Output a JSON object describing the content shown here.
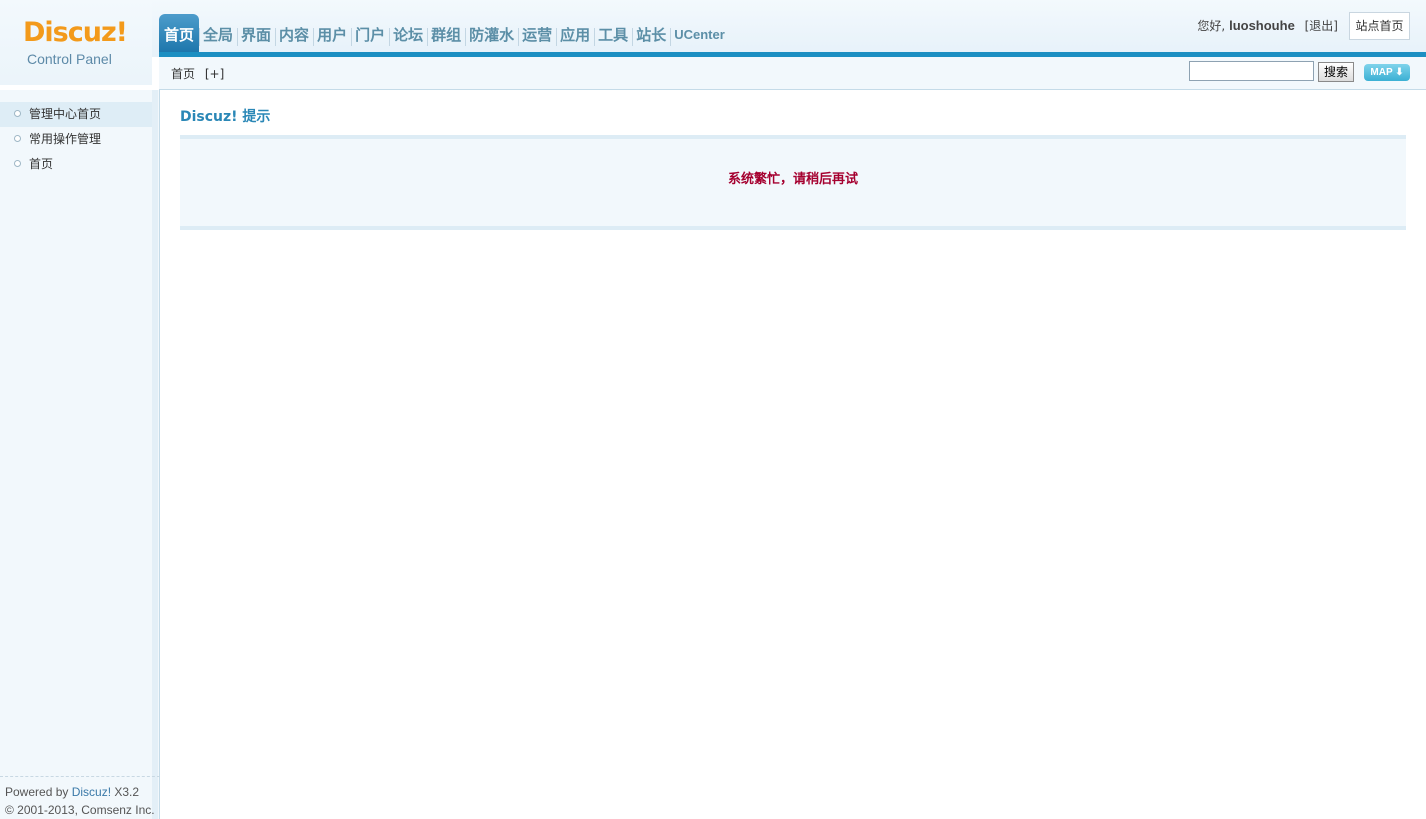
{
  "logo": {
    "wordmark": "Discuz!",
    "subtitle": "Control Panel"
  },
  "nav": {
    "items": [
      {
        "label": "首页",
        "active": true
      },
      {
        "label": "全局"
      },
      {
        "label": "界面"
      },
      {
        "label": "内容"
      },
      {
        "label": "用户"
      },
      {
        "label": "门户"
      },
      {
        "label": "论坛"
      },
      {
        "label": "群组"
      },
      {
        "label": "防灌水"
      },
      {
        "label": "运营"
      },
      {
        "label": "应用"
      },
      {
        "label": "工具"
      },
      {
        "label": "站长"
      },
      {
        "label": "UCenter"
      }
    ]
  },
  "user": {
    "greeting": "您好,",
    "username": "luoshouhe",
    "logout": "[退出]",
    "site_home": "站点首页"
  },
  "subbar": {
    "breadcrumb": "首页",
    "add": "[+]",
    "search_value": "",
    "search_button": "搜索",
    "map_button": "MAP ⬇"
  },
  "sidebar": {
    "items": [
      {
        "label": "管理中心首页"
      },
      {
        "label": "常用操作管理"
      },
      {
        "label": "首页"
      }
    ]
  },
  "footer": {
    "powered_prefix": "Powered by ",
    "powered_link": "Discuz!",
    "version": " X3.2",
    "copyright": "© 2001-2013, Comsenz Inc."
  },
  "main": {
    "title": "Discuz! 提示",
    "message": "系统繁忙，请稍后再试"
  },
  "colors": {
    "accent": "#1c8fc2",
    "logo_orange": "#f39a1b",
    "error_red": "#a5002f",
    "title_blue": "#2a87b6"
  }
}
